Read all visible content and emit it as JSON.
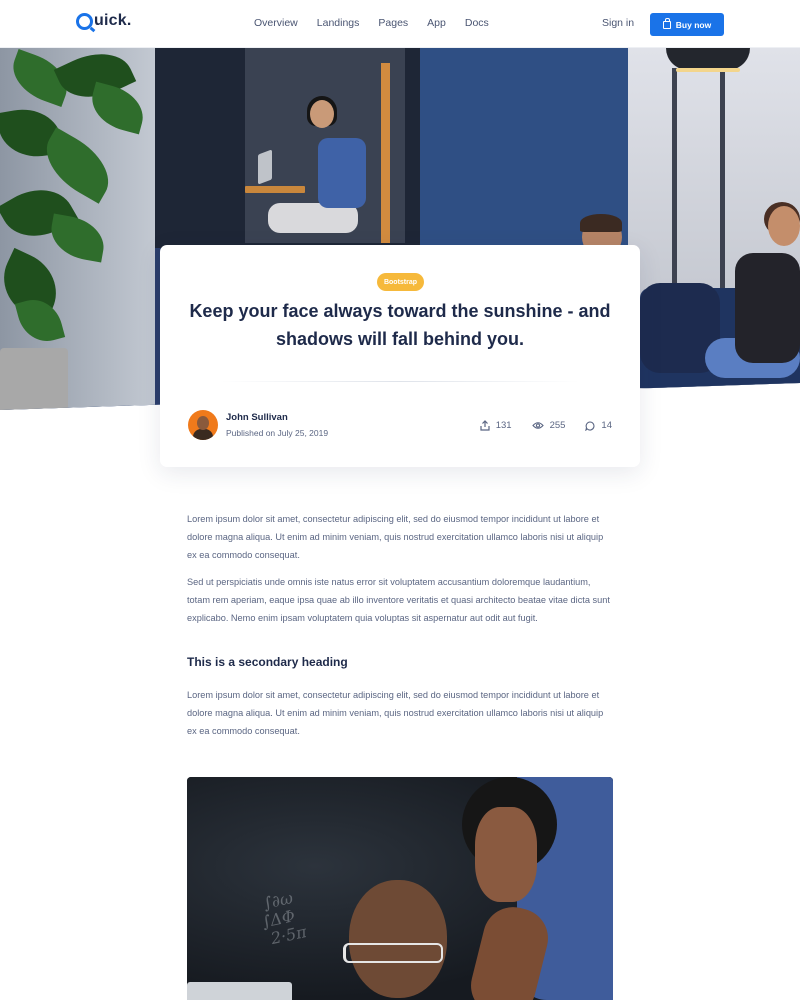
{
  "navbar": {
    "logo": "Quick.",
    "links": [
      "Overview",
      "Landings",
      "Pages",
      "App",
      "Docs"
    ],
    "signin": "Sign in",
    "buy_label": "Buy now"
  },
  "post": {
    "badge": "Bootstrap",
    "title": "Keep your face always toward the sunshine - and shadows will fall behind you.",
    "author": "John Sullivan",
    "published": "Published on July 25, 2019",
    "shares": "131",
    "views": "255",
    "comments": "14"
  },
  "article": {
    "p1": "Lorem ipsum dolor sit amet, consectetur adipiscing elit, sed do eiusmod tempor incididunt ut labore et dolore magna aliqua. Ut enim ad minim veniam, quis nostrud exercitation ullamco laboris nisi ut aliquip ex ea commodo consequat.",
    "p2": "Sed ut perspiciatis unde omnis iste natus error sit voluptatem accusantium doloremque laudantium, totam rem aperiam, eaque ipsa quae ab illo inventore veritatis et quasi architecto beatae vitae dicta sunt explicabo. Nemo enim ipsam voluptatem quia voluptas sit aspernatur aut odit aut fugit.",
    "heading": "This is a secondary heading",
    "p3": "Lorem ipsum dolor sit amet, consectetur adipiscing elit, sed do eiusmod tempor incididunt ut labore et dolore magna aliqua. Ut enim ad minim veniam, quis nostrud exercitation ullamco laboris nisi ut aliquip ex ea commodo consequat."
  },
  "colors": {
    "primary": "#1a73e8",
    "badge": "#f6b93b",
    "heading": "#1e2a4a",
    "text": "#5b6683"
  },
  "icons": [
    "shopping-bag-icon",
    "share-icon",
    "eye-icon",
    "comment-icon"
  ]
}
